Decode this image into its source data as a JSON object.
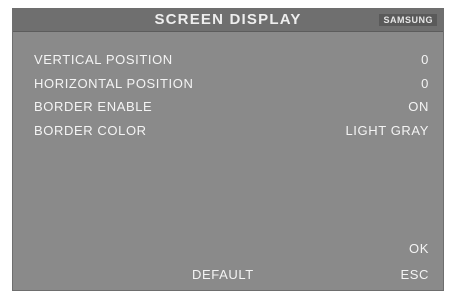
{
  "header": {
    "title": "SCREEN DISPLAY",
    "brand": "SAMSUNG"
  },
  "menu": {
    "items": [
      {
        "label": "VERTICAL POSITION",
        "value": "0"
      },
      {
        "label": "HORIZONTAL POSITION",
        "value": "0"
      },
      {
        "label": "BORDER ENABLE",
        "value": "ON"
      },
      {
        "label": "BORDER COLOR",
        "value": "LIGHT GRAY"
      }
    ]
  },
  "footer": {
    "ok_label": "OK",
    "default_label": "DEFAULT",
    "esc_label": "ESC"
  }
}
